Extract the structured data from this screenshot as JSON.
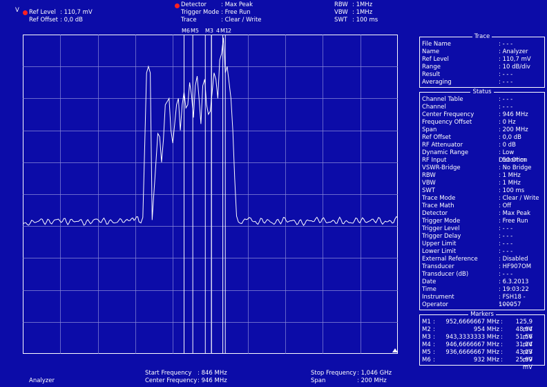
{
  "header": {
    "unit": "V",
    "ref_level_label": "Ref Level",
    "ref_level_value": ": 110,7 mV",
    "ref_offset_label": "Ref Offset",
    "ref_offset_value": ": 0,0 dB",
    "detector_label": "Detector",
    "detector_value": ": Max Peak",
    "trigger_mode_label": "Trigger Mode",
    "trigger_mode_value": ": Free Run",
    "trace_label": "Trace",
    "trace_value": ": Clear / Write",
    "rbw_label": "RBW",
    "rbw_value": ":   1MHz",
    "vbw_label": "VBW",
    "vbw_value": ":   1MHz",
    "swt_label": "SWT",
    "swt_value": ": 100 ms",
    "status_dot_color": "#ff2020"
  },
  "marker_labels": [
    "M6",
    "M5",
    "M3",
    "4",
    "M1",
    "2"
  ],
  "trace_panel": {
    "title": "Trace",
    "rows": [
      {
        "k": "File Name",
        "v": ": - - -"
      },
      {
        "k": "Name",
        "v": ": Analyzer"
      },
      {
        "k": "Ref Level",
        "v": ": 110,7  mV"
      },
      {
        "k": "Range",
        "v": ": 10 dB/div"
      },
      {
        "k": "Result",
        "v": ": - - -"
      },
      {
        "k": "Averaging",
        "v": ": - - -"
      }
    ]
  },
  "status_panel": {
    "title": "Status",
    "rows": [
      {
        "k": "Channel Table",
        "v": ": - - -"
      },
      {
        "k": "Channel",
        "v": ": - - -"
      },
      {
        "k": "Center Frequency",
        "v": ": 946     MHz"
      },
      {
        "k": "Frequency Offset",
        "v": ":     0     Hz"
      },
      {
        "k": "Span",
        "v": ": 200     MHz"
      },
      {
        "k": "Ref Offset",
        "v": ":   0,0    dB"
      },
      {
        "k": "RF Attenuator",
        "v": ":     0     dB"
      },
      {
        "k": "Dynamic Range",
        "v": ": Low Distortion"
      },
      {
        "k": "RF Input",
        "v": ":   50    Ohm"
      },
      {
        "k": "VSWR-Bridge",
        "v": ": No Bridge"
      },
      {
        "k": "RBW",
        "v": ":     1    MHz"
      },
      {
        "k": "VBW",
        "v": ":     1    MHz"
      },
      {
        "k": "SWT",
        "v": ":  100     ms"
      },
      {
        "k": "Trace Mode",
        "v": ": Clear / Write"
      },
      {
        "k": "Trace Math",
        "v": ": Off"
      },
      {
        "k": "Detector",
        "v": ": Max Peak"
      },
      {
        "k": "Trigger Mode",
        "v": ": Free Run"
      },
      {
        "k": "Trigger Level",
        "v": ": - - -"
      },
      {
        "k": "Trigger Delay",
        "v": ": - - -"
      },
      {
        "k": "Upper Limit",
        "v": ": - - -"
      },
      {
        "k": "Lower Limit",
        "v": ": - - -"
      },
      {
        "k": "External Reference",
        "v": ": Disabled"
      },
      {
        "k": "Transducer",
        "v": ": HF907OM"
      },
      {
        "k": "Transducer (dB)",
        "v": ": - - -"
      },
      {
        "k": "Date",
        "v": ": 6.3.2013"
      },
      {
        "k": "Time",
        "v": ": 19:03:22"
      },
      {
        "k": "Instrument",
        "v": ": FSH18 - 100057"
      },
      {
        "k": "Operator",
        "v": ": - - -"
      }
    ]
  },
  "markers_panel": {
    "title": "Markers",
    "rows": [
      {
        "n": "M1",
        "f": "952,6666667 MHz",
        "l": "125,9 mV"
      },
      {
        "n": "M2",
        "f": "954 MHz",
        "l": "48,94 mV"
      },
      {
        "n": "M3",
        "f": "943,3333333 MHz",
        "l": "51,56 mV"
      },
      {
        "n": "M4",
        "f": "946,6666667 MHz",
        "l": "31,24 mV"
      },
      {
        "n": "M5",
        "f": "936,6666667 MHz",
        "l": "43,23 mV"
      },
      {
        "n": "M6",
        "f": "932 MHz",
        "l": "25,99 mV"
      }
    ]
  },
  "footer": {
    "mode": "Analyzer",
    "start_freq_label": "Start Frequency",
    "start_freq_value": ": 846 MHz",
    "center_freq_label": "Center Frequency",
    "center_freq_value": ": 946 MHz",
    "stop_freq_label": "Stop Frequency",
    "stop_freq_value": ":   1,046 GHz",
    "span_label": "Span",
    "span_value": ":   200      MHz"
  },
  "chart_data": {
    "type": "line",
    "x_unit": "MHz",
    "xlim": [
      846,
      1046
    ],
    "grid": true,
    "noise_floor_fraction": 0.415,
    "series": [
      {
        "points": [
          [
            846,
            0.415
          ],
          [
            850,
            0.41
          ],
          [
            855,
            0.418
          ],
          [
            860,
            0.412
          ],
          [
            865,
            0.42
          ],
          [
            870,
            0.414
          ],
          [
            875,
            0.417
          ],
          [
            880,
            0.41
          ],
          [
            885,
            0.42
          ],
          [
            890,
            0.415
          ],
          [
            895,
            0.412
          ],
          [
            900,
            0.42
          ],
          [
            904,
            0.415
          ],
          [
            906,
            0.43
          ],
          [
            908,
            0.415
          ],
          [
            909,
            0.41
          ],
          [
            910,
            0.418
          ],
          [
            912,
            0.88
          ],
          [
            913,
            0.9
          ],
          [
            914,
            0.88
          ],
          [
            915,
            0.42
          ],
          [
            917,
            0.6
          ],
          [
            918,
            0.69
          ],
          [
            919,
            0.68
          ],
          [
            920,
            0.6
          ],
          [
            921,
            0.67
          ],
          [
            922,
            0.78
          ],
          [
            924,
            0.8
          ],
          [
            925,
            0.7
          ],
          [
            926,
            0.66
          ],
          [
            927,
            0.72
          ],
          [
            928,
            0.78
          ],
          [
            929,
            0.8
          ],
          [
            930,
            0.7
          ],
          [
            931,
            0.78
          ],
          [
            932,
            0.82
          ],
          [
            933,
            0.77
          ],
          [
            934,
            0.78
          ],
          [
            935,
            0.85
          ],
          [
            936,
            0.81
          ],
          [
            937,
            0.74
          ],
          [
            938,
            0.84
          ],
          [
            939,
            0.87
          ],
          [
            940,
            0.8
          ],
          [
            941,
            0.72
          ],
          [
            942,
            0.84
          ],
          [
            943,
            0.86
          ],
          [
            944,
            0.78
          ],
          [
            945,
            0.75
          ],
          [
            946,
            0.76
          ],
          [
            947,
            0.82
          ],
          [
            948,
            0.88
          ],
          [
            949,
            0.86
          ],
          [
            950,
            0.8
          ],
          [
            951,
            0.92
          ],
          [
            952,
            0.94
          ],
          [
            953,
            0.99
          ],
          [
            954,
            0.88
          ],
          [
            955,
            0.9
          ],
          [
            956,
            0.85
          ],
          [
            957,
            0.8
          ],
          [
            958,
            0.7
          ],
          [
            959,
            0.55
          ],
          [
            960,
            0.43
          ],
          [
            961,
            0.41
          ],
          [
            962,
            0.415
          ],
          [
            966,
            0.42
          ],
          [
            970,
            0.412
          ],
          [
            975,
            0.418
          ],
          [
            980,
            0.41
          ],
          [
            985,
            0.42
          ],
          [
            990,
            0.415
          ],
          [
            995,
            0.41
          ],
          [
            1000,
            0.418
          ],
          [
            1005,
            0.42
          ],
          [
            1010,
            0.412
          ],
          [
            1015,
            0.418
          ],
          [
            1020,
            0.41
          ],
          [
            1025,
            0.42
          ],
          [
            1030,
            0.415
          ],
          [
            1035,
            0.42
          ],
          [
            1040,
            0.41
          ],
          [
            1046,
            0.425
          ]
        ]
      }
    ],
    "marker_freqs_mhz": [
      952.6666667,
      954,
      943.3333333,
      946.6666667,
      936.6666667,
      932
    ]
  }
}
